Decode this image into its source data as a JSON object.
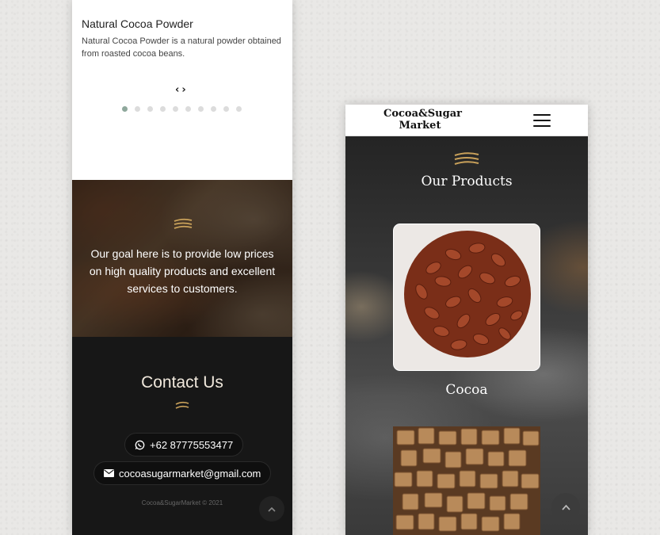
{
  "left_screen": {
    "product": {
      "title": "Natural Cocoa Powder",
      "description": "Natural Cocoa Powder is a natural powder obtained from roasted cocoa beans."
    },
    "carousel": {
      "arrows": "‹›",
      "total_dots": 10,
      "active_dot": 1
    },
    "goal_text": "Our goal here is to provide low prices on high quality products and excellent services to customers.",
    "contact": {
      "title": "Contact Us",
      "phone": "+62 87775553477",
      "email": "cocoasugarmarket@gmail.com"
    },
    "copyright": "Cocoa&SugarMarket © 2021"
  },
  "right_screen": {
    "brand": "Cocoa&Sugar Market",
    "section_title": "Our Products",
    "products": [
      {
        "name": "Cocoa"
      }
    ]
  },
  "colors": {
    "ornament_gold": "#c9a15a",
    "footer_bg": "#171717",
    "active_dot": "#8fa89c"
  },
  "icons": [
    "chevron-left-icon",
    "chevron-right-icon",
    "whatsapp-icon",
    "envelope-icon",
    "arrow-up-icon",
    "hamburger-menu-icon",
    "wheat-ornament-icon"
  ]
}
